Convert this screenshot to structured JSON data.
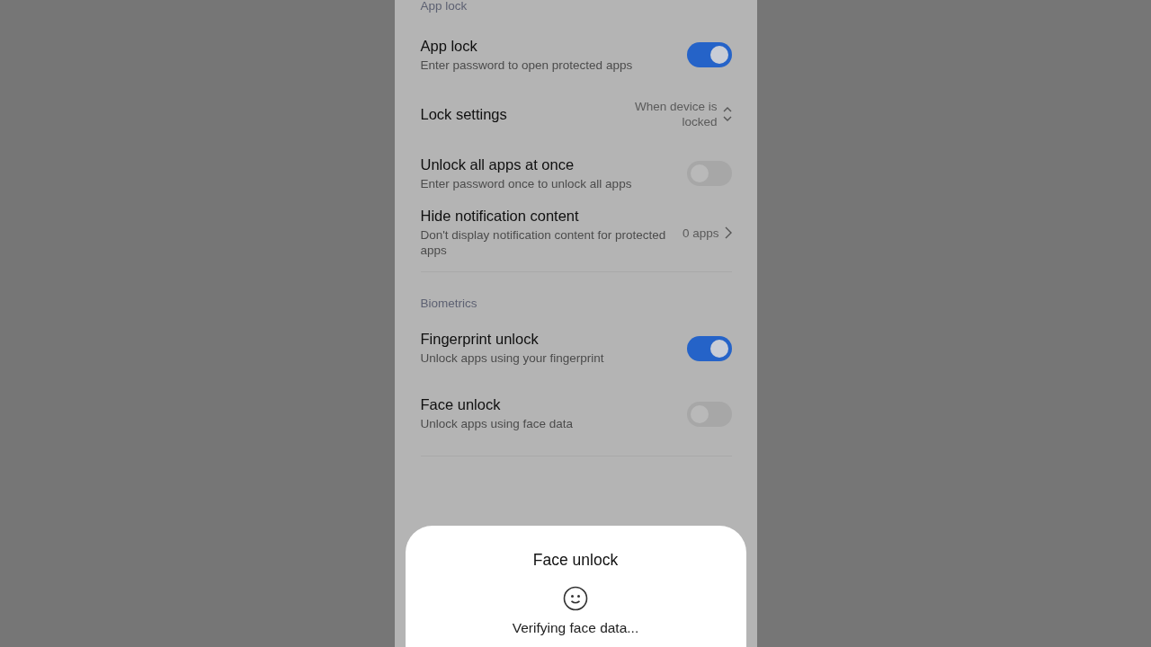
{
  "sections": [
    {
      "header": "App lock",
      "items": [
        {
          "kind": "toggle",
          "title": "App lock",
          "subtitle": "Enter password to open protected apps",
          "on": true
        },
        {
          "kind": "select",
          "title": "Lock settings",
          "value": "When device is locked"
        },
        {
          "kind": "toggle",
          "title": "Unlock all apps at once",
          "subtitle": "Enter password once to unlock all apps",
          "on": false
        },
        {
          "kind": "link",
          "title": "Hide notification content",
          "subtitle": "Don't display notification content for protected apps",
          "value": "0 apps"
        }
      ]
    },
    {
      "header": "Biometrics",
      "items": [
        {
          "kind": "toggle",
          "title": "Fingerprint unlock",
          "subtitle": "Unlock apps using your fingerprint",
          "on": true
        },
        {
          "kind": "toggle",
          "title": "Face unlock",
          "subtitle": "Unlock apps using face data",
          "on": false
        }
      ]
    }
  ],
  "dialog": {
    "title": "Face unlock",
    "message": "Verifying face data..."
  }
}
